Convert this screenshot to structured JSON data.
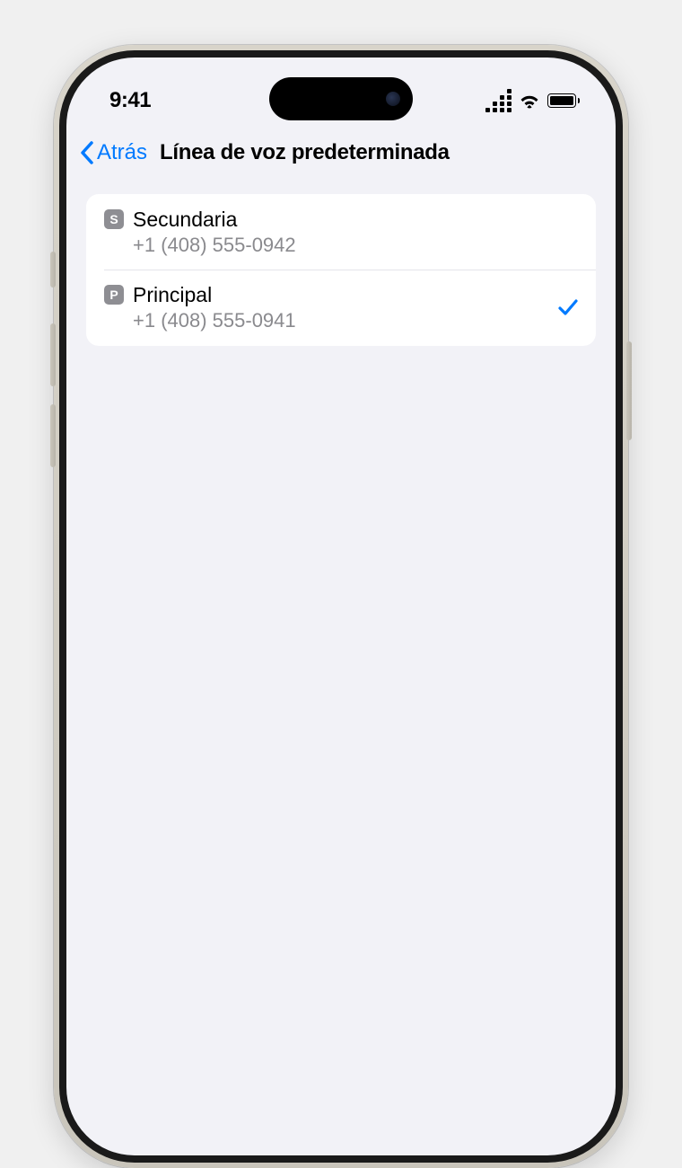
{
  "status": {
    "time": "9:41"
  },
  "nav": {
    "back_label": "Atrás",
    "title": "Línea de voz predeterminada"
  },
  "lines": [
    {
      "badge": "S",
      "label": "Secundaria",
      "number": "+1 (408) 555-0942",
      "selected": false
    },
    {
      "badge": "P",
      "label": "Principal",
      "number": "+1 (408) 555-0941",
      "selected": true
    }
  ],
  "colors": {
    "accent": "#007aff",
    "badge_bg": "#8e8e93",
    "screen_bg": "#f2f2f7"
  }
}
